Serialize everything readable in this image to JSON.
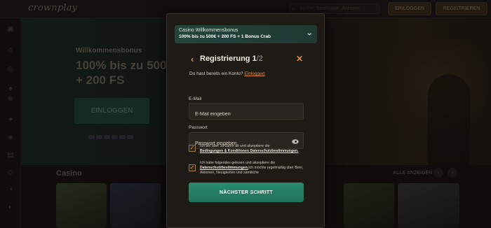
{
  "site": {
    "logo_text": "crownplay",
    "search_placeholder": "Suche: Spielname, Anbieter",
    "header_login": "EINLOGGEN",
    "header_register": "REGISTRIEREN"
  },
  "hero": {
    "kicker": "Willkommensbonus",
    "headline": "100% bis zu 500€ + 200 FS",
    "cta": "EINLOGGEN"
  },
  "casino_section": {
    "title": "Casino",
    "see_all": "ALLE ANZEIGEN"
  },
  "modal": {
    "promo": {
      "title": "Casino Willkommensbonus",
      "subtitle": "100% bis zu 500€ + 200 FS + 1 Bonus Crab"
    },
    "title": "Registrierung 1",
    "step_count": "/2",
    "have_account_text": "Du hast bereits ein Konto?",
    "have_account_link": "Einloggen",
    "email": {
      "label": "E-Mail",
      "placeholder": "E-Mail eingeben",
      "value": ""
    },
    "password": {
      "label": "Passwort",
      "placeholder": "Passwort eingeben",
      "value": ""
    },
    "consent_age": {
      "checked": true,
      "text_prefix": "Ich bin über 18 Jahre alt und akzeptiere die",
      "link": "Bedingungen & Konditionen Datenschutzbestimmungen."
    },
    "consent_marketing": {
      "checked": true,
      "text_prefix": "Ich habe folgendes gelesen und akzeptiere die",
      "link": "Datenschutzbestimmungen.",
      "text_suffix": "Ich möchte regelmäßig über Boni, Aktionen, Neuigkeiten und sämtliche"
    },
    "next_button": "NÄCHSTER SCHRITT"
  },
  "colors": {
    "accent_orange": "#e08a3a",
    "primary_green": "#1f7258",
    "banner_green": "#24443a",
    "modal_bg": "#1e1b17"
  },
  "icons": {
    "back": "chevron-left-icon",
    "close": "close-icon",
    "promo_toggle": "chevron-down-icon",
    "password_toggle": "eye-icon",
    "checkbox": "check-icon"
  }
}
